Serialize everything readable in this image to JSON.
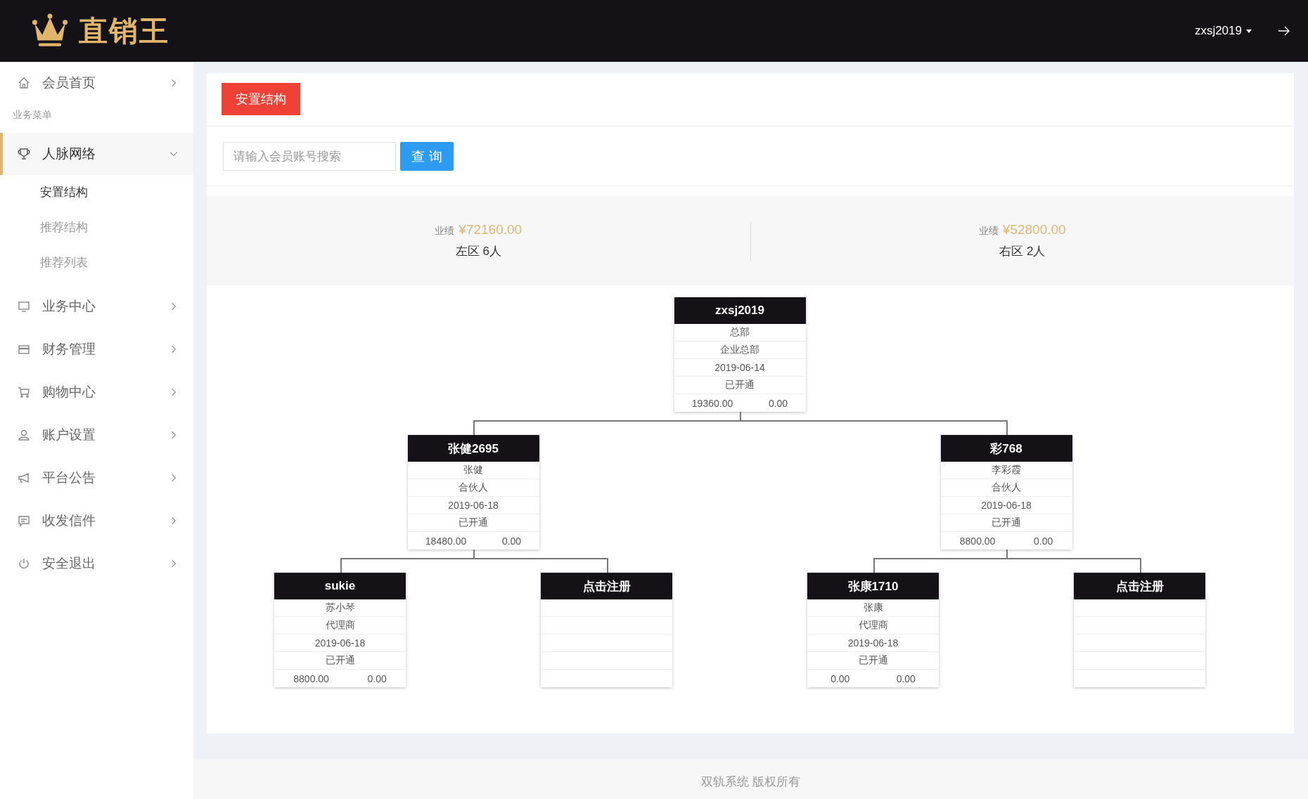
{
  "header": {
    "logo_text": "直销王",
    "user": "zxsj2019"
  },
  "sidebar": {
    "items": [
      {
        "kind": "menu",
        "label": "会员首页",
        "selected": false,
        "expanded": false
      },
      {
        "kind": "section",
        "label": "业务菜单"
      },
      {
        "kind": "menu",
        "label": "人脉网络",
        "selected": true,
        "expanded": true,
        "children": [
          {
            "label": "安置结构",
            "selected": true
          },
          {
            "label": "推荐结构",
            "selected": false
          },
          {
            "label": "推荐列表",
            "selected": false
          }
        ]
      },
      {
        "kind": "menu",
        "label": "业务中心",
        "selected": false,
        "expanded": false
      },
      {
        "kind": "menu",
        "label": "财务管理",
        "selected": false,
        "expanded": false
      },
      {
        "kind": "menu",
        "label": "购物中心",
        "selected": false,
        "expanded": false
      },
      {
        "kind": "menu",
        "label": "账户设置",
        "selected": false,
        "expanded": false
      },
      {
        "kind": "menu",
        "label": "平台公告",
        "selected": false,
        "expanded": false
      },
      {
        "kind": "menu",
        "label": "收发信件",
        "selected": false,
        "expanded": false
      },
      {
        "kind": "menu",
        "label": "安全退出",
        "selected": false,
        "expanded": false
      }
    ]
  },
  "content": {
    "tab_button": "安置结构",
    "search": {
      "placeholder": "请输入会员账号搜索",
      "button": "查 询"
    },
    "stats": [
      {
        "label": "业绩",
        "amount": "¥72160.00",
        "zone": "左区 6人"
      },
      {
        "label": "业绩",
        "amount": "¥52800.00",
        "zone": "右区 2人"
      }
    ],
    "tree": {
      "kind": "member",
      "title": "zxsj2019",
      "name": "总部",
      "level": "企业总部",
      "date": "2019-06-14",
      "status": "已开通",
      "amount_1": "19360.00",
      "amount_2": "0.00",
      "children": [
        {
          "kind": "member",
          "title": "张健2695",
          "name": "张健",
          "level": "合伙人",
          "date": "2019-06-18",
          "status": "已开通",
          "amount_1": "18480.00",
          "amount_2": "0.00",
          "children": [
            {
              "kind": "member",
              "title": "sukie",
              "name": "苏小琴",
              "level": "代理商",
              "date": "2019-06-18",
              "status": "已开通",
              "amount_1": "8800.00",
              "amount_2": "0.00"
            },
            {
              "kind": "register",
              "title": "点击注册"
            }
          ]
        },
        {
          "kind": "member",
          "title": "彩768",
          "name": "李彩霞",
          "level": "合伙人",
          "date": "2019-06-18",
          "status": "已开通",
          "amount_1": "8800.00",
          "amount_2": "0.00",
          "children": [
            {
              "kind": "member",
              "title": "张康1710",
              "name": "张康",
              "level": "代理商",
              "date": "2019-06-18",
              "status": "已开通",
              "amount_1": "0.00",
              "amount_2": "0.00"
            },
            {
              "kind": "register",
              "title": "点击注册"
            }
          ]
        }
      ]
    }
  },
  "footer": {
    "text": "双轨系统 版权所有"
  }
}
